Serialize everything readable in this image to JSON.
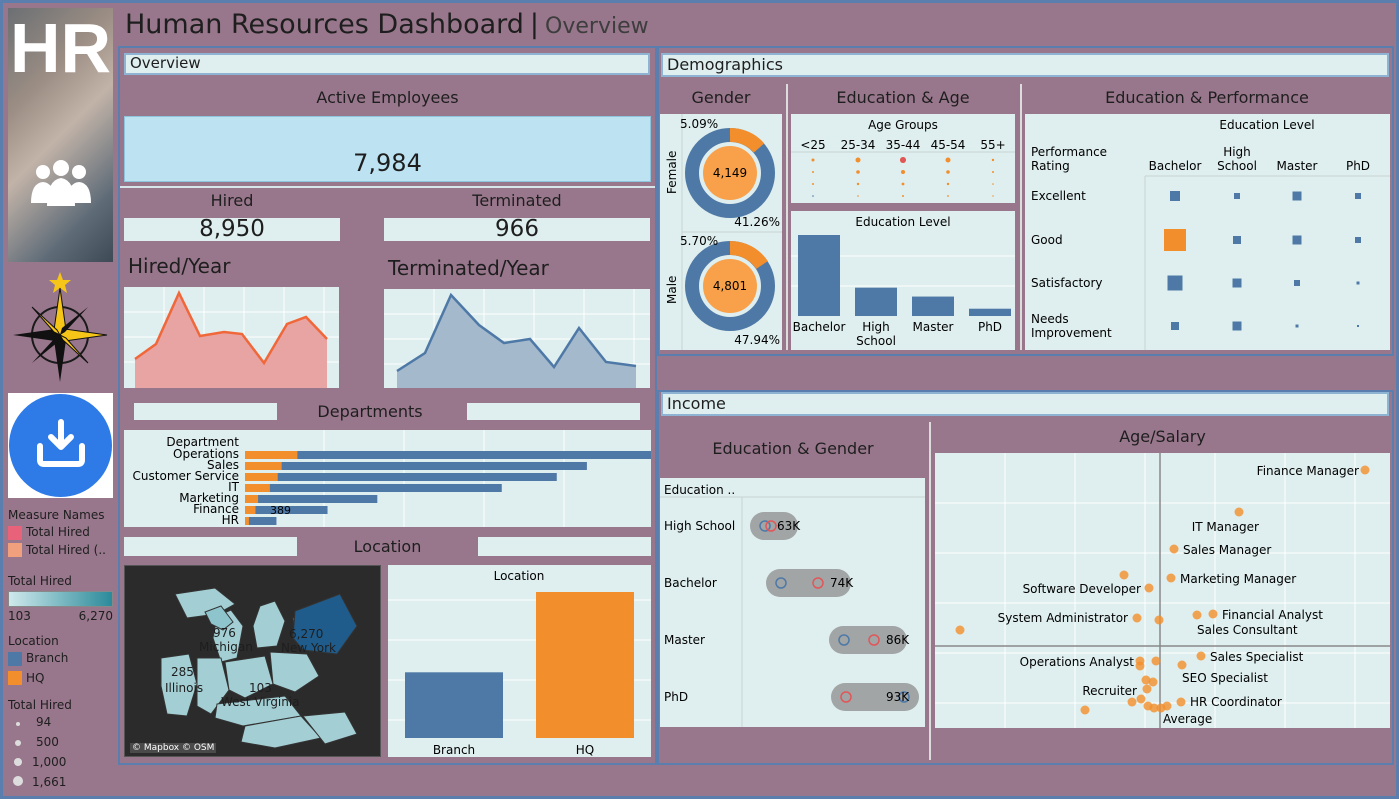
{
  "header": {
    "title": "Human Resources Dashboard",
    "subtitle": "Overview"
  },
  "sidebar": {
    "hr_logo": "HR",
    "legends": {
      "measure_names_title": "Measure Names",
      "measure_items": [
        "Total Hired",
        "Total Hired (.."
      ],
      "total_hired_title": "Total Hired",
      "total_hired_min": "103",
      "total_hired_max": "6,270",
      "location_title": "Location",
      "location_items": [
        "Branch",
        "HQ"
      ],
      "size_title": "Total Hired",
      "size_items": [
        "94",
        "500",
        "1,000",
        "1,661"
      ]
    }
  },
  "overview": {
    "title": "Overview",
    "active_title": "Active Employees",
    "active_value": "7,984",
    "hired_label": "Hired",
    "hired_value": "8,950",
    "terminated_label": "Terminated",
    "terminated_value": "966",
    "hired_year_title": "Hired/Year",
    "terminated_year_title": "Terminated/Year",
    "departments_title": "Departments",
    "location_title": "Location"
  },
  "departments": {
    "header": "Department",
    "rows": [
      {
        "name": "Operations",
        "orange": 40,
        "total": 387
      },
      {
        "name": "Sales",
        "orange": 28,
        "total": 261
      },
      {
        "name": "Customer Service",
        "orange": 25,
        "total": 238
      },
      {
        "name": "IT",
        "orange": 19,
        "total": 196
      },
      {
        "name": "Marketing",
        "orange": 10,
        "total": 101
      },
      {
        "name": "Finance",
        "orange": 8,
        "total": 63,
        "label": "389"
      },
      {
        "name": "HR",
        "orange": 3,
        "total": 24
      }
    ]
  },
  "map": {
    "labels": [
      {
        "val": "976",
        "name": "Michigan"
      },
      {
        "val": "6,270",
        "name": "New York"
      },
      {
        "val": "285",
        "name": "Illinois"
      },
      {
        "val": "103",
        "name": "West Virginia"
      }
    ],
    "credit": "© Mapbox © OSM"
  },
  "location_bar": {
    "title": "Location",
    "categories": [
      "Branch",
      "HQ"
    ],
    "values": [
      0.45,
      1.0
    ]
  },
  "demographics": {
    "title": "Demographics",
    "gender_title": "Gender",
    "female": {
      "label": "Female",
      "center": "4,149",
      "top": "5.09%",
      "bottom": "41.26%"
    },
    "male": {
      "label": "Male",
      "center": "4,801",
      "top": "5.70%",
      "bottom": "47.94%"
    },
    "edu_age_title": "Education & Age",
    "age_groups_title": "Age Groups",
    "age_groups": [
      "<25",
      "25-34",
      "35-44",
      "45-54",
      "55+"
    ],
    "edu_level_title": "Education Level",
    "edu_levels": [
      "Bachelor",
      "High School",
      "Master",
      "PhD"
    ],
    "edu_values": [
      100,
      35,
      24,
      9
    ],
    "edu_perf_title": "Education & Performance",
    "perf_rating_label": "Performance Rating",
    "perf_edu_title": "Education Level",
    "perf_cols": [
      "Bachelor",
      "High School",
      "Master",
      "PhD"
    ],
    "perf_rows": [
      "Excellent",
      "Good",
      "Satisfactory",
      "Needs Improvement"
    ],
    "perf_sizes": [
      [
        10,
        6,
        9,
        6
      ],
      [
        22,
        8,
        9,
        6
      ],
      [
        15,
        9,
        6,
        3
      ],
      [
        8,
        9,
        3,
        2
      ]
    ]
  },
  "income": {
    "title": "Income",
    "edu_gender_title": "Education & Gender",
    "edu_col_header": "Education ..",
    "rows": [
      {
        "label": "High School",
        "value": "63K"
      },
      {
        "label": "Bachelor",
        "value": "74K"
      },
      {
        "label": "Master",
        "value": "86K"
      },
      {
        "label": "PhD",
        "value": "93K"
      }
    ],
    "age_salary_title": "Age/Salary",
    "scatter_labels": [
      "Finance Manager",
      "IT Manager",
      "Sales Manager",
      "Software Developer",
      "Marketing Manager",
      "System Administrator",
      "Financial Analyst",
      "Sales Consultant",
      "Operations Analyst",
      "Sales Specialist",
      "SEO Specialist",
      "Recruiter",
      "HR Coordinator",
      "Average"
    ]
  },
  "colors": {
    "blue": "#4e79a7",
    "orange": "#f28e2b",
    "pink": "#e8a3a3",
    "red": "#e8684a",
    "light": "#dfeeee",
    "bg": "#98778c"
  }
}
